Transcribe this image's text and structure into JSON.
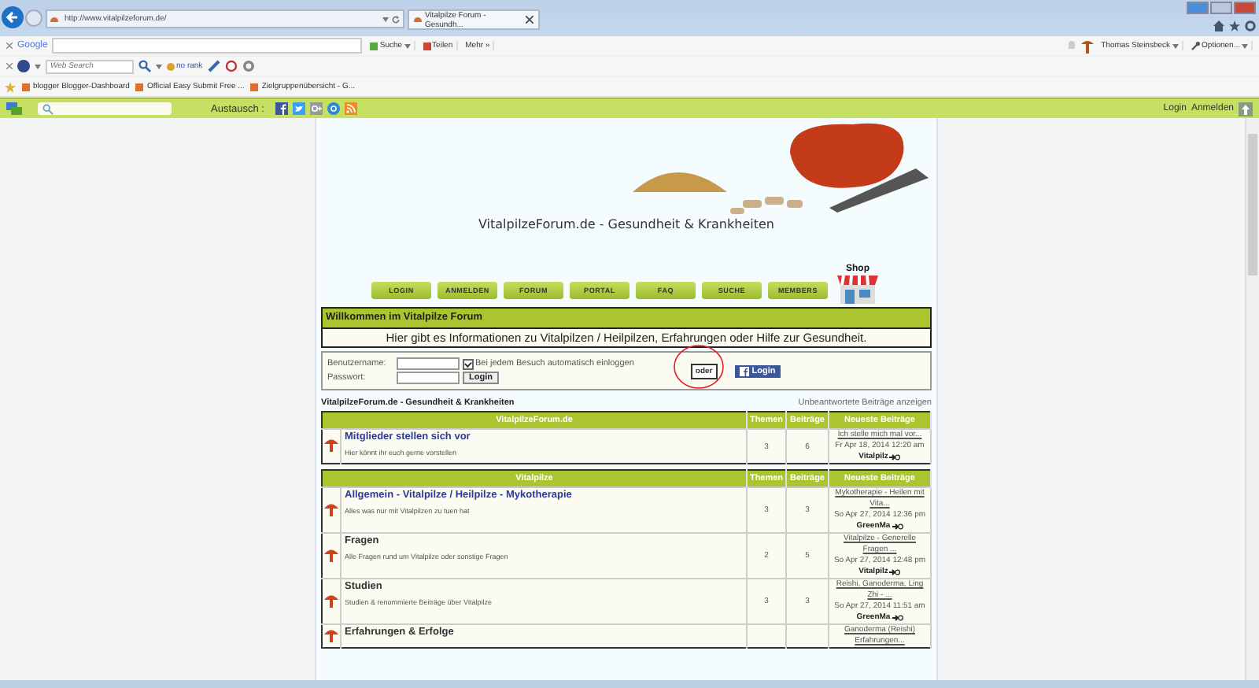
{
  "browser": {
    "address": "http://www.vitalpilzeforum.de/",
    "tabs": [
      {
        "title": "Vitalpilze Forum - Gesundh...",
        "selected": true
      }
    ],
    "toolbar": {
      "google_label": "Google",
      "search_button": "Suche",
      "share_button": "Teilen",
      "more_button": "Mehr »",
      "user": "Thomas Steinsbeck",
      "options": "Optionen..."
    },
    "search_toolbar": {
      "placeholder": "Web Search",
      "rank": "no rank"
    },
    "bookmarks": [
      "blogger Blogger-Dashboard",
      "Official Easy Submit Free ...",
      "Zielgruppenübersicht - G..."
    ]
  },
  "site_bar": {
    "share_label": "Austausch :",
    "links": [
      "Login",
      "Anmelden"
    ]
  },
  "forum": {
    "title": "VitalpilzeForum.de - Gesundheit & Krankheiten",
    "nav": [
      "LOGIN",
      "ANMELDEN",
      "FORUM",
      "PORTAL",
      "FAQ",
      "SUCHE",
      "MEMBERS"
    ],
    "shop_label": "Shop",
    "welcome": {
      "title": "Willkommen im Vitalpilze Forum",
      "text": "Hier gibt es Informationen zu Vitalpilzen / Heilpilzen, Erfahrungen oder Hilfe zur Gesundheit."
    },
    "login": {
      "username_label": "Benutzername:",
      "password_label": "Passwort:",
      "remember_label": "Bei jedem Besuch automatisch einloggen",
      "remember_checked": true,
      "login_button": "Login",
      "or_label": "oder",
      "facebook_button": "Login"
    },
    "breadcrumb": "VitalpilzeForum.de - Gesundheit & Krankheiten",
    "unanswered_link": "Unbeantwortete Beiträge anzeigen",
    "categories": [
      {
        "name": "VitalpilzeForum.de",
        "columns": [
          "Themen",
          "Beiträge",
          "Neueste Beiträge"
        ],
        "forums": [
          {
            "title": "Mitglieder stellen sich vor",
            "description": "Hier könnt ihr euch gerne vorstellen",
            "topics": "3",
            "posts": "6",
            "last_title": "Ich stelle mich mal vor...",
            "last_date": "Fr Apr 18, 2014 12:20 am",
            "last_author": "Vitalpilz"
          }
        ]
      },
      {
        "name": "Vitalpilze",
        "columns": [
          "Themen",
          "Beiträge",
          "Neueste Beiträge"
        ],
        "forums": [
          {
            "title": "Allgemein - Vitalpilze / Heilpilze - Mykotherapie",
            "description": "Alles was nur mit Vitalpilzen zu tuen hat",
            "topics": "3",
            "posts": "3",
            "last_title": "Mykotherapie - Heilen mit Vita...",
            "last_date": "So Apr 27, 2014 12:36 pm",
            "last_author": "GreenMa"
          },
          {
            "title": "Fragen",
            "description": "Alle Fragen rund um Vitalpilze oder sonstige Fragen",
            "topics": "2",
            "posts": "5",
            "last_title": "Vitalpilze - Generelle Fragen ...",
            "last_date": "So Apr 27, 2014 12:48 pm",
            "last_author": "Vitalpilz"
          },
          {
            "title": "Studien",
            "description": "Studien & renommierte Beiträge über Vitalpilze",
            "topics": "3",
            "posts": "3",
            "last_title": "Reishi, Ganoderma, Ling Zhi - ...",
            "last_date": "So Apr 27, 2014 11:51 am",
            "last_author": "GreenMa"
          },
          {
            "title": "Erfahrungen & Erfolge",
            "last_title": "Ganoderma (Reishi) Erfahrungen..."
          }
        ]
      }
    ]
  }
}
